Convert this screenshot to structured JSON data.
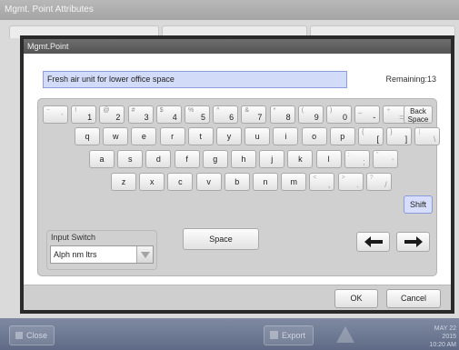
{
  "window": {
    "title": "Mgmt. Point Attributes"
  },
  "dialog": {
    "title": "Mgmt.Point",
    "text_value": "Fresh air unit for lower office space",
    "remaining_label": "Remaining:13",
    "rows": [
      [
        {
          "upper": "~",
          "lower": "`",
          "enabled": false
        },
        {
          "upper": "!",
          "lower": "1",
          "enabled": true
        },
        {
          "upper": "@",
          "lower": "2",
          "enabled": true
        },
        {
          "upper": "#",
          "lower": "3",
          "enabled": true
        },
        {
          "upper": "$",
          "lower": "4",
          "enabled": true
        },
        {
          "upper": "%",
          "lower": "5",
          "enabled": true
        },
        {
          "upper": "^",
          "lower": "6",
          "enabled": true
        },
        {
          "upper": "&",
          "lower": "7",
          "enabled": true
        },
        {
          "upper": "*",
          "lower": "8",
          "enabled": true
        },
        {
          "upper": "(",
          "lower": "9",
          "enabled": true
        },
        {
          "upper": ")",
          "lower": "0",
          "enabled": true
        },
        {
          "upper": "_",
          "lower": "-",
          "enabled": true
        },
        {
          "upper": "+",
          "lower": "=",
          "enabled": false
        }
      ],
      [
        {
          "upper": "",
          "lower": "q",
          "enabled": true
        },
        {
          "upper": "",
          "lower": "w",
          "enabled": true
        },
        {
          "upper": "",
          "lower": "e",
          "enabled": true
        },
        {
          "upper": "",
          "lower": "r",
          "enabled": true
        },
        {
          "upper": "",
          "lower": "t",
          "enabled": true
        },
        {
          "upper": "",
          "lower": "y",
          "enabled": true
        },
        {
          "upper": "",
          "lower": "u",
          "enabled": true
        },
        {
          "upper": "",
          "lower": "i",
          "enabled": true
        },
        {
          "upper": "",
          "lower": "o",
          "enabled": true
        },
        {
          "upper": "",
          "lower": "p",
          "enabled": true
        },
        {
          "upper": "{",
          "lower": "[",
          "enabled": true
        },
        {
          "upper": "}",
          "lower": "]",
          "enabled": true
        },
        {
          "upper": "|",
          "lower": "\\",
          "enabled": false
        }
      ],
      [
        {
          "upper": "",
          "lower": "a",
          "enabled": true
        },
        {
          "upper": "",
          "lower": "s",
          "enabled": true
        },
        {
          "upper": "",
          "lower": "d",
          "enabled": true
        },
        {
          "upper": "",
          "lower": "f",
          "enabled": true
        },
        {
          "upper": "",
          "lower": "g",
          "enabled": true
        },
        {
          "upper": "",
          "lower": "h",
          "enabled": true
        },
        {
          "upper": "",
          "lower": "j",
          "enabled": true
        },
        {
          "upper": "",
          "lower": "k",
          "enabled": true
        },
        {
          "upper": "",
          "lower": "l",
          "enabled": true
        },
        {
          "upper": ":",
          "lower": ";",
          "enabled": false
        },
        {
          "upper": "\"",
          "lower": "'",
          "enabled": false
        }
      ],
      [
        {
          "upper": "",
          "lower": "z",
          "enabled": true
        },
        {
          "upper": "",
          "lower": "x",
          "enabled": true
        },
        {
          "upper": "",
          "lower": "c",
          "enabled": true
        },
        {
          "upper": "",
          "lower": "v",
          "enabled": true
        },
        {
          "upper": "",
          "lower": "b",
          "enabled": true
        },
        {
          "upper": "",
          "lower": "n",
          "enabled": true
        },
        {
          "upper": "",
          "lower": "m",
          "enabled": true
        },
        {
          "upper": "<",
          "lower": ",",
          "enabled": false
        },
        {
          "upper": ">",
          "lower": ".",
          "enabled": false
        },
        {
          "upper": "?",
          "lower": "/",
          "enabled": false
        }
      ]
    ],
    "backspace_label": [
      "Back",
      "Space"
    ],
    "shift_label": "Shift",
    "space_label": "Space",
    "left_arrow_icon": "arrow-left-icon",
    "right_arrow_icon": "arrow-right-icon",
    "input_switch": {
      "label": "Input Switch",
      "value": "Alph nm ltrs"
    },
    "ok_label": "OK",
    "cancel_label": "Cancel"
  },
  "taskbar": {
    "close_label": "Close",
    "export_label": "Export",
    "warning_icon": "warning-icon",
    "clock": [
      "MAY 22 2015",
      "10:20 AM"
    ]
  },
  "colors": {
    "text_field_bg": "#d2dcf8",
    "shift_bg": "#d6defb",
    "dialog_border": "#2a2a2a",
    "taskbar": "#6a7590"
  }
}
